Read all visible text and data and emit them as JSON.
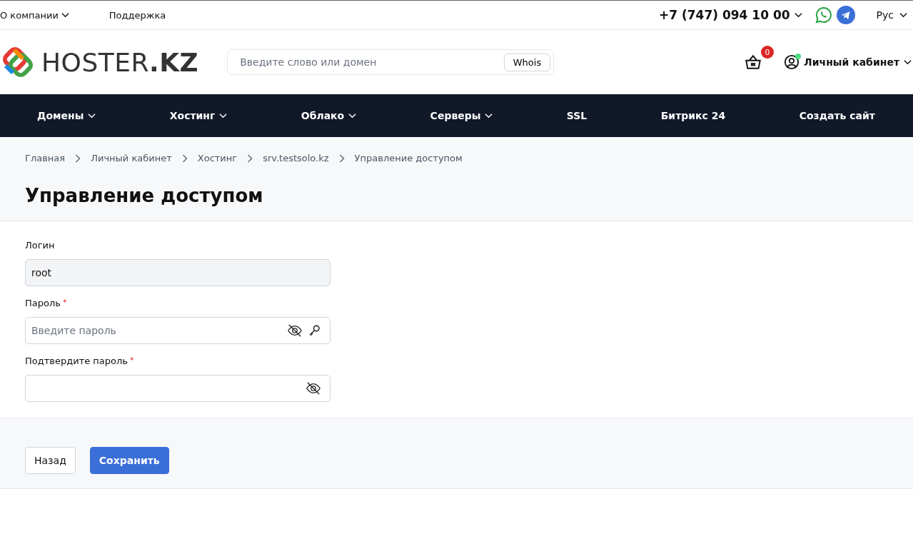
{
  "top_bar": {
    "links": [
      {
        "label": "О компании",
        "dropdown": true
      },
      {
        "label": "Поддержка",
        "dropdown": false
      }
    ],
    "phone": "+7 (747) 094 10 00",
    "language": "Рус"
  },
  "header": {
    "logo": "HOSTER**.KZ**",
    "search": {
      "placeholder": "Введите слово или домен",
      "button": "Whois"
    },
    "cart_count": "0",
    "account": {
      "label": "Личный кабинет",
      "online": true
    }
  },
  "nav": [
    {
      "label": "Домены",
      "dropdown": true
    },
    {
      "label": "Хостинг",
      "dropdown": true
    },
    {
      "label": "Облако",
      "dropdown": true
    },
    {
      "label": "Серверы",
      "dropdown": true
    },
    {
      "label": "SSL",
      "dropdown": false
    },
    {
      "label": "Битрикс 24",
      "dropdown": false
    },
    {
      "label": "Создать сайт",
      "dropdown": false
    }
  ],
  "breadcrumbs": [
    "Главная",
    "Личный кабинет",
    "Хостинг",
    "srv.testsolo.kz",
    "Управление доступом"
  ],
  "title": "Управление доступом",
  "fields": [
    {
      "kind": "text",
      "label": "Логин",
      "disabled": true,
      "value": "root"
    },
    {
      "kind": "password-generator",
      "label": "Пароль",
      "required_mark": "*",
      "disabled": false,
      "placeholder": "Введите пароль"
    },
    {
      "kind": "password",
      "label": "Подтвердите пароль",
      "required_mark": "*",
      "disabled": false
    }
  ],
  "buttons": {
    "back": "Назад",
    "save": "Сохранить"
  }
}
